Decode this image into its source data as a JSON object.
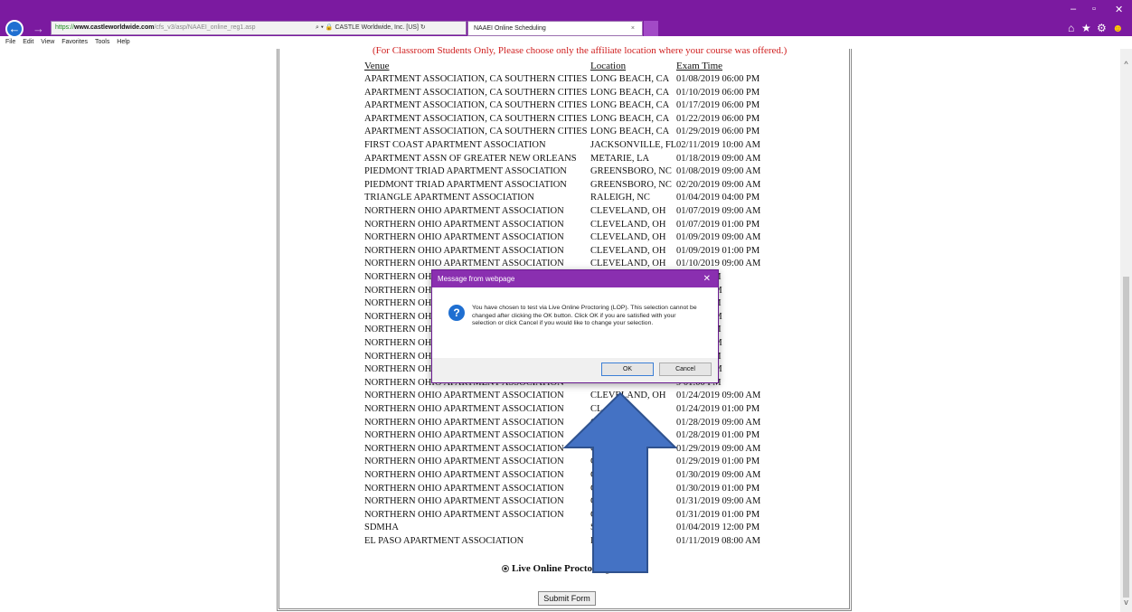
{
  "browser": {
    "address": {
      "scheme": "https://",
      "domain": "www.castleworldwide.com",
      "path": "/cfs_v3/asp/NAAEI_online_reg1.asp",
      "search_glyph": "⌕ ▾",
      "lock_glyph": "🔒",
      "site_identity": "CASTLE Worldwide, Inc. [US]",
      "refresh_glyph": "↻"
    },
    "tab": {
      "title": "NAAEI Online Scheduling",
      "close": "×"
    },
    "window_controls": {
      "minimize": "–",
      "maximize": "▫",
      "close": "✕"
    },
    "toolbar_icons": {
      "home": "⌂",
      "favorites": "★",
      "settings": "⚙",
      "feedback": "☻"
    },
    "menu": [
      "File",
      "Edit",
      "View",
      "Favorites",
      "Tools",
      "Help"
    ]
  },
  "page": {
    "note": "(For Classroom Students Only, Please choose only the affiliate location where your course was offered.)",
    "headers": {
      "venue": "Venue",
      "location": "Location",
      "time": "Exam Time"
    },
    "rows": [
      {
        "venue": "APARTMENT ASSOCIATION, CA SOUTHERN CITIES",
        "location": "LONG BEACH, CA",
        "time": "01/08/2019 06:00 PM"
      },
      {
        "venue": "APARTMENT ASSOCIATION, CA SOUTHERN CITIES",
        "location": "LONG BEACH, CA",
        "time": "01/10/2019 06:00 PM"
      },
      {
        "venue": "APARTMENT ASSOCIATION, CA SOUTHERN CITIES",
        "location": "LONG BEACH, CA",
        "time": "01/17/2019 06:00 PM"
      },
      {
        "venue": "APARTMENT ASSOCIATION, CA SOUTHERN CITIES",
        "location": "LONG BEACH, CA",
        "time": "01/22/2019 06:00 PM"
      },
      {
        "venue": "APARTMENT ASSOCIATION, CA SOUTHERN CITIES",
        "location": "LONG BEACH, CA",
        "time": "01/29/2019 06:00 PM"
      },
      {
        "venue": "FIRST COAST APARTMENT ASSOCIATION",
        "location": "JACKSONVILLE, FL",
        "time": "02/11/2019 10:00 AM"
      },
      {
        "venue": "APARTMENT ASSN OF GREATER NEW ORLEANS",
        "location": "METARIE, LA",
        "time": "01/18/2019 09:00 AM"
      },
      {
        "venue": "PIEDMONT TRIAD APARTMENT ASSOCIATION",
        "location": "GREENSBORO, NC",
        "time": "01/08/2019 09:00 AM"
      },
      {
        "venue": "PIEDMONT TRIAD APARTMENT ASSOCIATION",
        "location": "GREENSBORO, NC",
        "time": "02/20/2019 09:00 AM"
      },
      {
        "venue": "TRIANGLE APARTMENT ASSOCIATION",
        "location": "RALEIGH, NC",
        "time": "01/04/2019 04:00 PM"
      },
      {
        "venue": "NORTHERN OHIO APARTMENT ASSOCIATION",
        "location": "CLEVELAND, OH",
        "time": "01/07/2019 09:00 AM"
      },
      {
        "venue": "NORTHERN OHIO APARTMENT ASSOCIATION",
        "location": "CLEVELAND, OH",
        "time": "01/07/2019 01:00 PM"
      },
      {
        "venue": "NORTHERN OHIO APARTMENT ASSOCIATION",
        "location": "CLEVELAND, OH",
        "time": "01/09/2019 09:00 AM"
      },
      {
        "venue": "NORTHERN OHIO APARTMENT ASSOCIATION",
        "location": "CLEVELAND, OH",
        "time": "01/09/2019 01:00 PM"
      },
      {
        "venue": "NORTHERN OHIO APARTMENT ASSOCIATION",
        "location": "CLEVELAND, OH",
        "time": "01/10/2019 09:00 AM"
      },
      {
        "venue": "NORTHERN OHIO APARTMENT ASSOCIATION",
        "location": "",
        "time": "9 01:00 PM"
      },
      {
        "venue": "NORTHERN OHIO APARTMENT ASSOCIATION",
        "location": "",
        "time": "9 09:00 AM"
      },
      {
        "venue": "NORTHERN OHIO APARTMENT ASSOCIATION",
        "location": "",
        "time": "9 01:00 PM"
      },
      {
        "venue": "NORTHERN OHIO APARTMENT ASSOCIATION",
        "location": "",
        "time": "9 09:00 AM"
      },
      {
        "venue": "NORTHERN OHIO APARTMENT ASSOCIATION",
        "location": "",
        "time": "9 01:00 PM"
      },
      {
        "venue": "NORTHERN OHIO APARTMENT ASSOCIATION",
        "location": "",
        "time": "9 09:00 AM"
      },
      {
        "venue": "NORTHERN OHIO APARTMENT ASSOCIATION",
        "location": "",
        "time": "9 01:00 PM"
      },
      {
        "venue": "NORTHERN OHIO APARTMENT ASSOCIATION",
        "location": "",
        "time": "9 09:00 AM"
      },
      {
        "venue": "NORTHERN OHIO APARTMENT ASSOCIATION",
        "location": "",
        "time": "9 01:00 PM"
      },
      {
        "venue": "NORTHERN OHIO APARTMENT ASSOCIATION",
        "location": "CLEVELAND, OH",
        "time": "01/24/2019 09:00 AM"
      },
      {
        "venue": "NORTHERN OHIO APARTMENT ASSOCIATION",
        "location": "CL",
        "time": "01/24/2019 01:00 PM"
      },
      {
        "venue": "NORTHERN OHIO APARTMENT ASSOCIATION",
        "location": "CL",
        "time": "01/28/2019 09:00 AM"
      },
      {
        "venue": "NORTHERN OHIO APARTMENT ASSOCIATION",
        "location": "CL",
        "time": "01/28/2019 01:00 PM"
      },
      {
        "venue": "NORTHERN OHIO APARTMENT ASSOCIATION",
        "location": "CL",
        "time": "01/29/2019 09:00 AM"
      },
      {
        "venue": "NORTHERN OHIO APARTMENT ASSOCIATION",
        "location": "CL",
        "time": "01/29/2019 01:00 PM"
      },
      {
        "venue": "NORTHERN OHIO APARTMENT ASSOCIATION",
        "location": "CL",
        "time": "01/30/2019 09:00 AM"
      },
      {
        "venue": "NORTHERN OHIO APARTMENT ASSOCIATION",
        "location": "CL",
        "time": "01/30/2019 01:00 PM"
      },
      {
        "venue": "NORTHERN OHIO APARTMENT ASSOCIATION",
        "location": "CL",
        "time": "01/31/2019 09:00 AM"
      },
      {
        "venue": "NORTHERN OHIO APARTMENT ASSOCIATION",
        "location": "CL",
        "time": "01/31/2019 01:00 PM"
      },
      {
        "venue": "SDMHA",
        "location": "SI",
        "time": "01/04/2019 12:00 PM"
      },
      {
        "venue": "EL PASO APARTMENT ASSOCIATION",
        "location": "EL",
        "time": "01/11/2019 08:00 AM"
      }
    ],
    "radio_label": "Live Online Proctoring",
    "submit_label": "Submit Form"
  },
  "dialog": {
    "title": "Message from webpage",
    "close": "✕",
    "icon": "?",
    "message": "You have chosen to test via Live Online Proctoring (LOP). This selection cannot be changed after clicking the OK button. Click OK if you are satisfied with your selection or click Cancel if you would like to change your selection.",
    "ok": "OK",
    "cancel": "Cancel"
  },
  "colors": {
    "chrome": "#7b1aa0",
    "dialog_title": "#8a2fb0",
    "note_red": "#d02020",
    "arrow_fill": "#4472c4",
    "arrow_stroke": "#2f528f"
  },
  "scroll": {
    "up": "^",
    "down": "v"
  }
}
